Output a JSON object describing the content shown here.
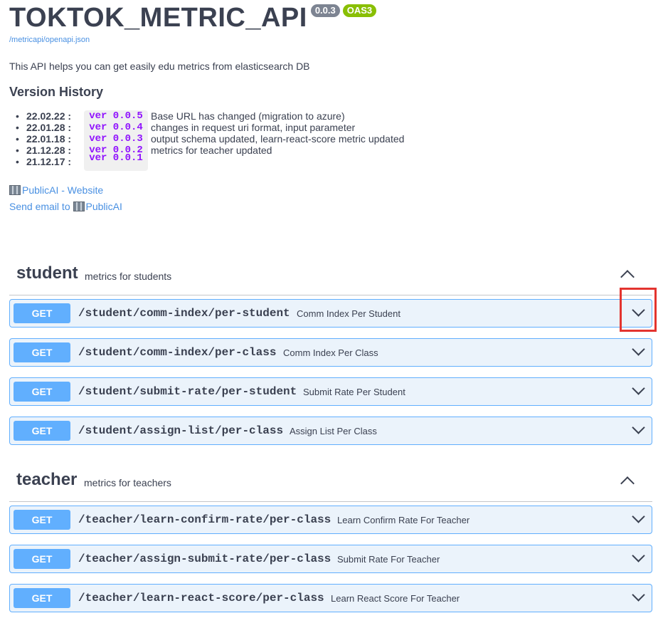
{
  "info": {
    "title": "TOKTOK_METRIC_API",
    "version_badge": "0.0.3",
    "oas_badge": "OAS3",
    "spec_link": "/metricapi/openapi.json",
    "description": "This API helps you can get easily edu metrics from elasticsearch DB",
    "version_history_heading": "Version History",
    "history": [
      {
        "date": "22.02.22",
        "sep": ":",
        "ver": "ver 0.0.5",
        "note": "Base URL has changed (migration to azure)"
      },
      {
        "date": "22.01.28",
        "sep": ":",
        "ver": "ver 0.0.4",
        "note": "changes in request uri format, input parameter"
      },
      {
        "date": "22.01.18",
        "sep": ":",
        "ver": "ver 0.0.3",
        "note": "output schema updated, learn-react-score metric updated"
      },
      {
        "date": "21.12.28",
        "sep": ":",
        "ver": "ver 0.0.2",
        "note": "metrics for teacher updated"
      },
      {
        "date": "21.12.17",
        "sep": ":",
        "ver": "ver 0.0.1",
        "note": ""
      }
    ],
    "website_link": "PublicAI - Website",
    "email_link_prefix": "Send email to ",
    "email_link_name": "PublicAI"
  },
  "tags": [
    {
      "name": "student",
      "description": "metrics for students",
      "operations": [
        {
          "method": "GET",
          "path": "/student/comm-index/per-student",
          "summary": "Comm Index Per Student"
        },
        {
          "method": "GET",
          "path": "/student/comm-index/per-class",
          "summary": "Comm Index Per Class"
        },
        {
          "method": "GET",
          "path": "/student/submit-rate/per-student",
          "summary": "Submit Rate Per Student"
        },
        {
          "method": "GET",
          "path": "/student/assign-list/per-class",
          "summary": "Assign List Per Class"
        }
      ]
    },
    {
      "name": "teacher",
      "description": "metrics for teachers",
      "operations": [
        {
          "method": "GET",
          "path": "/teacher/learn-confirm-rate/per-class",
          "summary": "Learn Confirm Rate For Teacher"
        },
        {
          "method": "GET",
          "path": "/teacher/assign-submit-rate/per-class",
          "summary": "Submit Rate For Teacher"
        },
        {
          "method": "GET",
          "path": "/teacher/learn-react-score/per-class",
          "summary": "Learn React Score For Teacher"
        }
      ]
    }
  ],
  "colors": {
    "get_method": "#61affe",
    "get_bg": "#ebf3fb",
    "link": "#4990e2",
    "highlight": "#e3342f"
  }
}
